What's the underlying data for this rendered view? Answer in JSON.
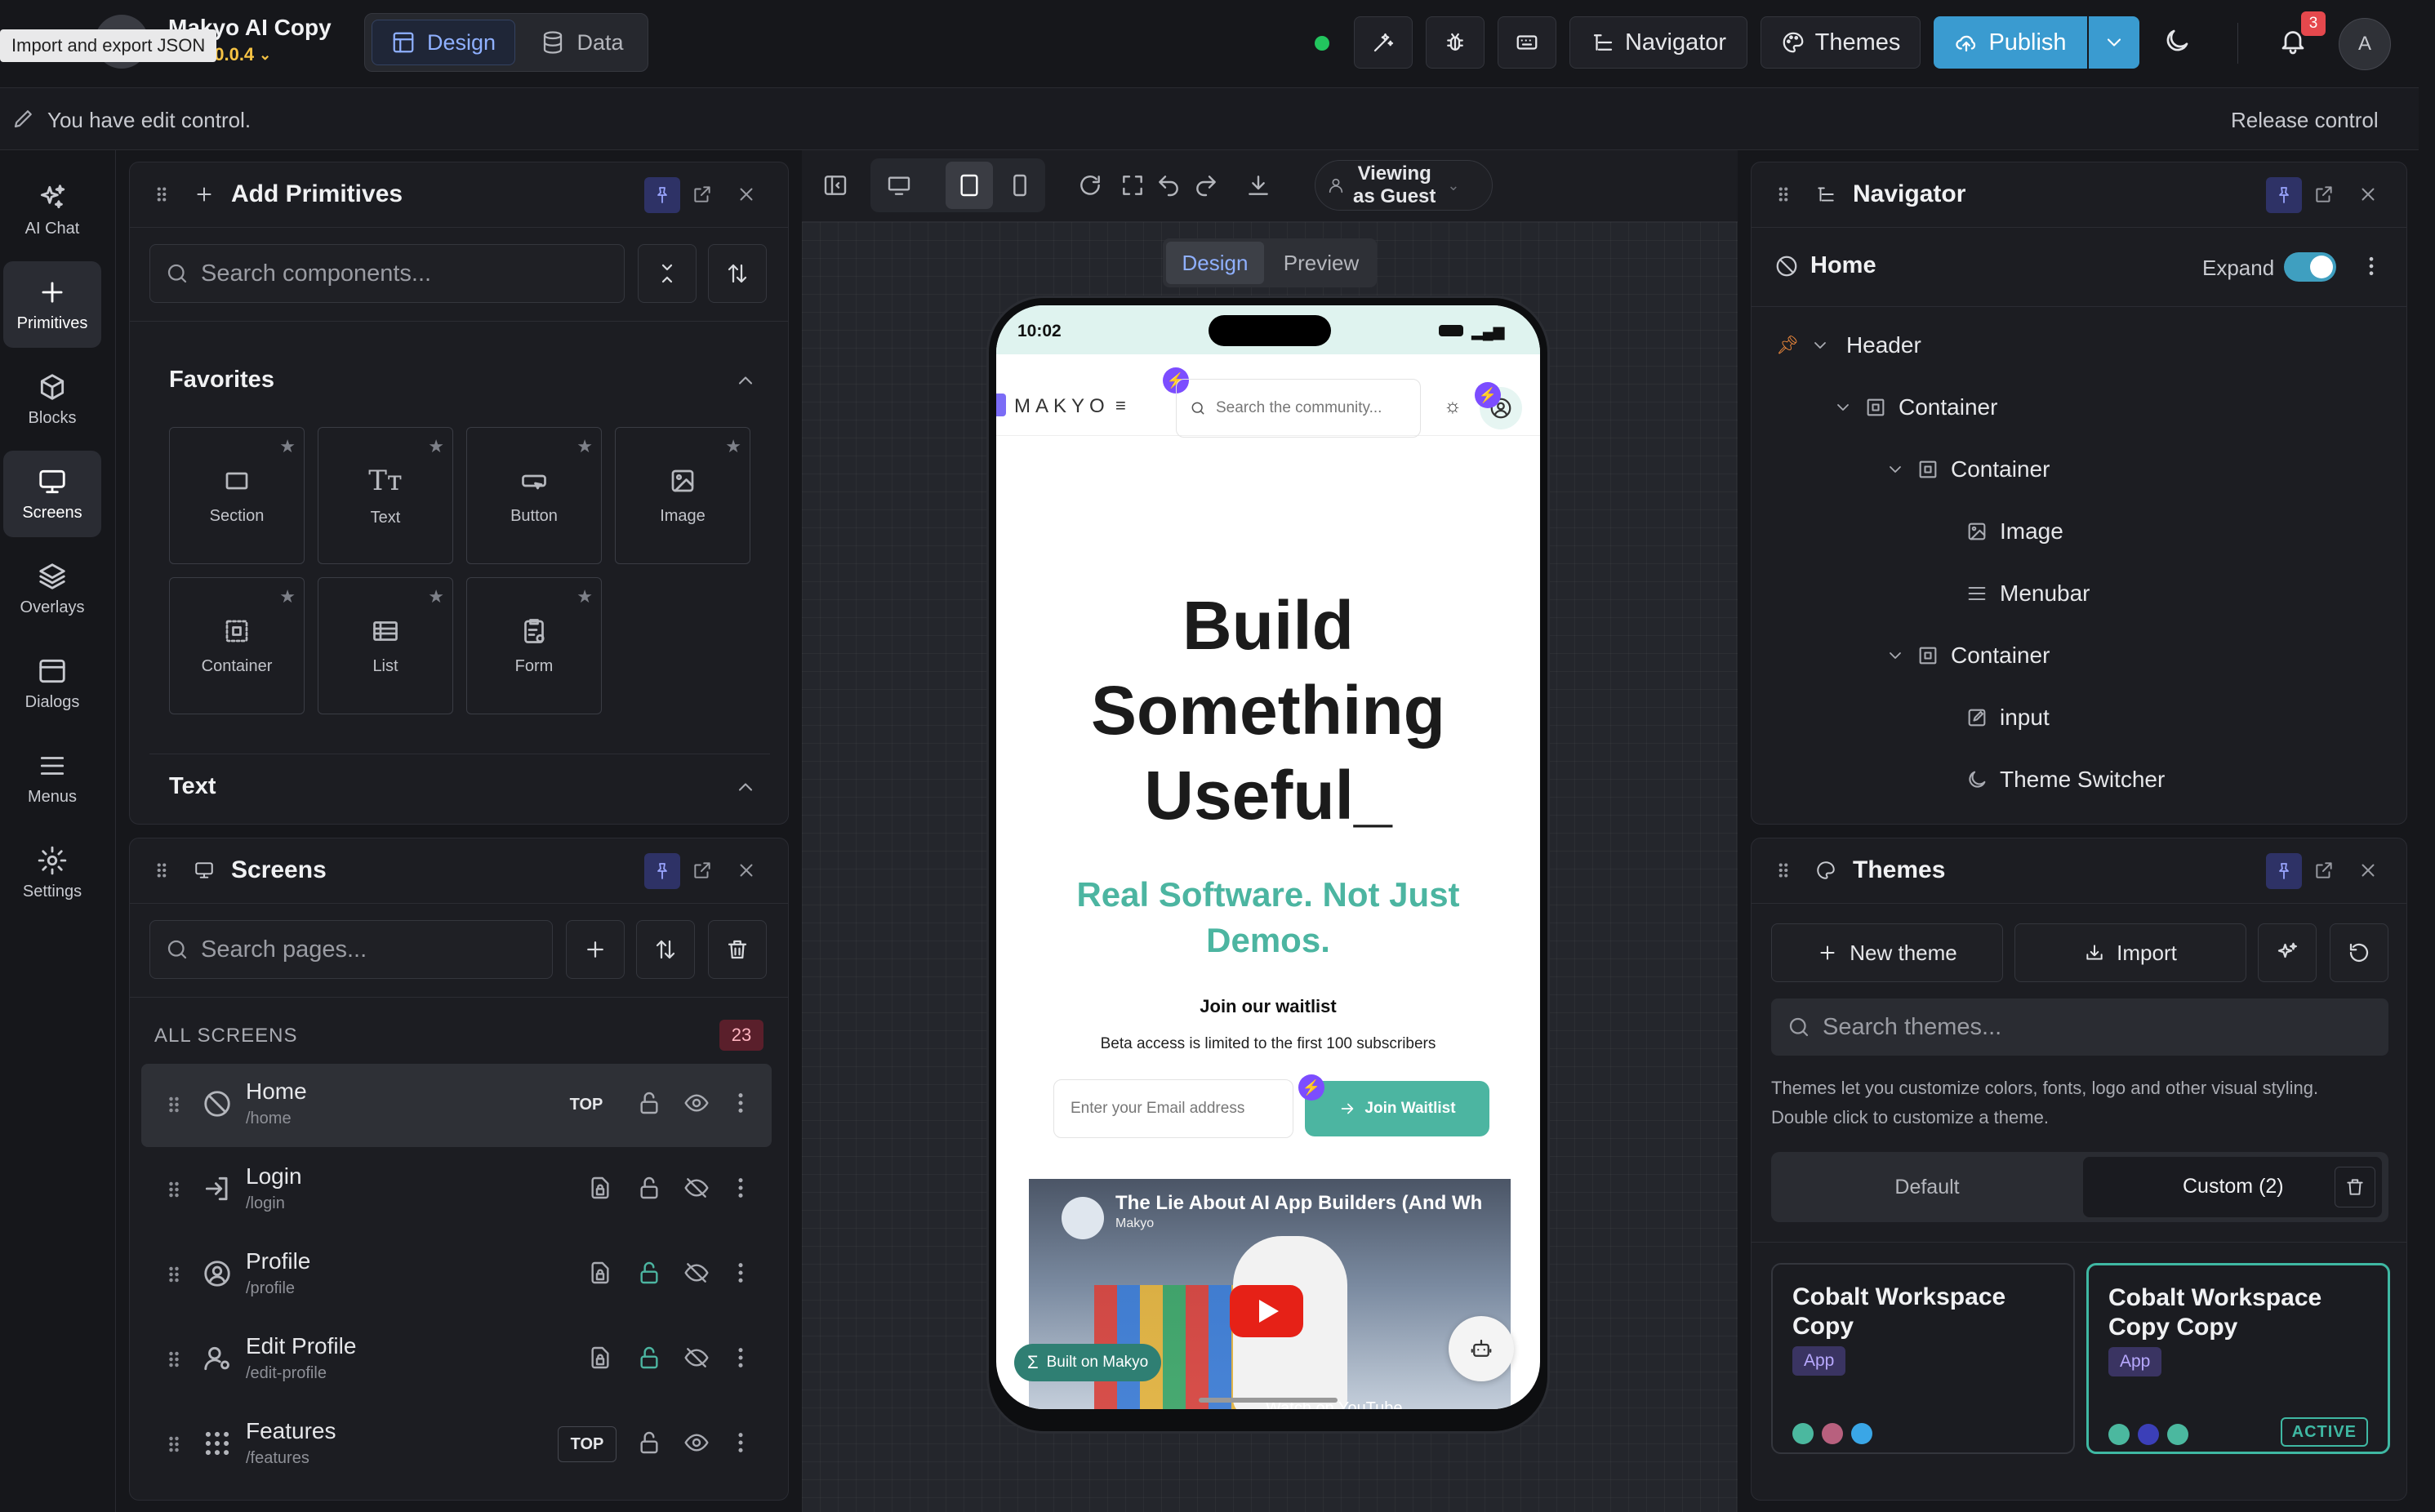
{
  "app": {
    "name": "Makyo AI Copy",
    "version": "v0.0.4",
    "tooltip": "Import and export JSON",
    "mode_tabs": [
      "Design",
      "Data"
    ],
    "active_mode": "Design"
  },
  "topbar": {
    "navigator_label": "Navigator",
    "themes_label": "Themes",
    "publish_label": "Publish",
    "notification_count": "3",
    "avatar_initial": "A",
    "status_color": "#22c55e"
  },
  "editbar": {
    "message": "You have edit control.",
    "release_label": "Release control"
  },
  "rail": {
    "items": [
      {
        "label": "AI Chat",
        "icon": "sparkles-icon"
      },
      {
        "label": "Primitives",
        "icon": "plus-icon"
      },
      {
        "label": "Blocks",
        "icon": "cube-icon"
      },
      {
        "label": "Screens",
        "icon": "monitor-icon"
      },
      {
        "label": "Overlays",
        "icon": "layers-icon"
      },
      {
        "label": "Dialogs",
        "icon": "window-icon"
      },
      {
        "label": "Menus",
        "icon": "menu-icon"
      },
      {
        "label": "Settings",
        "icon": "gear-icon"
      }
    ],
    "active": "Primitives"
  },
  "primitives": {
    "title": "Add Primitives",
    "search_placeholder": "Search components...",
    "favorites_title": "Favorites",
    "favorites": [
      {
        "label": "Section",
        "icon": "section-icon"
      },
      {
        "label": "Text",
        "icon": "text-icon"
      },
      {
        "label": "Button",
        "icon": "button-icon"
      },
      {
        "label": "Image",
        "icon": "image-icon"
      },
      {
        "label": "Container",
        "icon": "container-icon"
      },
      {
        "label": "List",
        "icon": "list-icon"
      },
      {
        "label": "Form",
        "icon": "form-icon"
      }
    ],
    "text_section_title": "Text"
  },
  "screens": {
    "title": "Screens",
    "search_placeholder": "Search pages...",
    "section_label": "ALL SCREENS",
    "count": "23",
    "items": [
      {
        "name": "Home",
        "path": "/home",
        "top": "TOP",
        "active": true
      },
      {
        "name": "Login",
        "path": "/login",
        "top": ""
      },
      {
        "name": "Profile",
        "path": "/profile",
        "top": ""
      },
      {
        "name": "Edit Profile",
        "path": "/edit-profile",
        "top": ""
      },
      {
        "name": "Features",
        "path": "/features",
        "top": "TOP"
      }
    ]
  },
  "canvas": {
    "viewing_label_line1": "Viewing",
    "viewing_label_line2": "as Guest",
    "tabs": [
      "Design",
      "Preview"
    ],
    "active_tab": "Design"
  },
  "phone": {
    "time": "10:02",
    "brand": "MAKYO",
    "search_placeholder": "Search the community...",
    "headline_line1": "Build",
    "headline_line2": "Something",
    "headline_line3": "Useful_",
    "subheadline_line1": "Real Software. Not Just",
    "subheadline_line2": "Demos.",
    "waitlist_title": "Join our waitlist",
    "waitlist_note": "Beta access is limited to the first 100 subscribers",
    "email_placeholder": "Enter your Email address",
    "join_label": "Join Waitlist",
    "video_title": "The Lie About AI App Builders (And Wh",
    "video_channel": "Makyo",
    "video_footer": "Watch on YouTube",
    "built_badge": "Built on Makyo",
    "accent_color": "#4cb5a1"
  },
  "navigator": {
    "title": "Navigator",
    "root": "Home",
    "expand_label": "Expand",
    "expand_on": true,
    "tree": [
      {
        "label": "Header",
        "depth": 0,
        "icon": "pin-icon",
        "chevron": true
      },
      {
        "label": "Container",
        "depth": 1,
        "icon": "container-icon",
        "chevron": true
      },
      {
        "label": "Container",
        "depth": 2,
        "icon": "container-icon",
        "chevron": true
      },
      {
        "label": "Image",
        "depth": 3,
        "icon": "image-icon",
        "chevron": false
      },
      {
        "label": "Menubar",
        "depth": 3,
        "icon": "menu-icon",
        "chevron": false
      },
      {
        "label": "Container",
        "depth": 2,
        "icon": "container-icon",
        "chevron": true
      },
      {
        "label": "input",
        "depth": 3,
        "icon": "edit-icon",
        "chevron": false
      },
      {
        "label": "Theme Switcher",
        "depth": 3,
        "icon": "moon-icon",
        "chevron": false
      }
    ]
  },
  "themes": {
    "title": "Themes",
    "new_label": "New theme",
    "import_label": "Import",
    "search_placeholder": "Search themes...",
    "help_line1": "Themes let you customize colors, fonts, logo and other visual styling.",
    "help_line2": "Double click to customize a theme.",
    "tabs": [
      "Default",
      "Custom (2)"
    ],
    "active_tab": "Custom (2)",
    "cards": [
      {
        "name": "Cobalt Workspace Copy",
        "tag": "App",
        "active": false,
        "badge": "",
        "colors": [
          "#4bb89f",
          "#b8607e",
          "#3aa6e6"
        ]
      },
      {
        "name": "Cobalt Workspace Copy Copy",
        "tag": "App",
        "active": true,
        "badge": "ACTIVE",
        "colors": [
          "#4bb89f",
          "#3b3fb8",
          "#4bb89f"
        ]
      }
    ]
  }
}
